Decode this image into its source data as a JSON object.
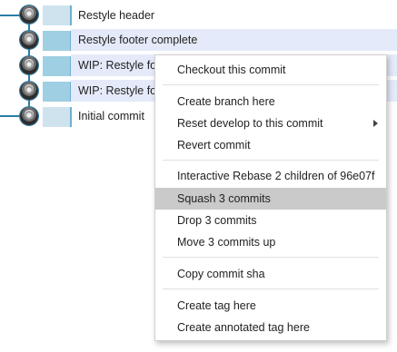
{
  "commits": [
    {
      "message": "Restyle header",
      "selected": false
    },
    {
      "message": "Restyle footer complete",
      "selected": true
    },
    {
      "message": "WIP: Restyle fo",
      "selected": true
    },
    {
      "message": "WIP: Restyle fo",
      "selected": true
    },
    {
      "message": "Initial commit",
      "selected": false
    }
  ],
  "context_menu": {
    "checkout": "Checkout this commit",
    "create_branch": "Create branch here",
    "reset": "Reset develop to this commit",
    "revert": "Revert commit",
    "interactive_rebase": "Interactive Rebase 2 children of 96e07f",
    "squash": "Squash 3 commits",
    "drop": "Drop 3 commits",
    "move_up": "Move 3 commits up",
    "copy_sha": "Copy commit sha",
    "create_tag": "Create tag here",
    "create_annotated_tag": "Create annotated tag here"
  },
  "colors": {
    "graph": "#2a7da8",
    "selection_row": "#e4eaf9",
    "menu_hover": "#cacaca"
  }
}
